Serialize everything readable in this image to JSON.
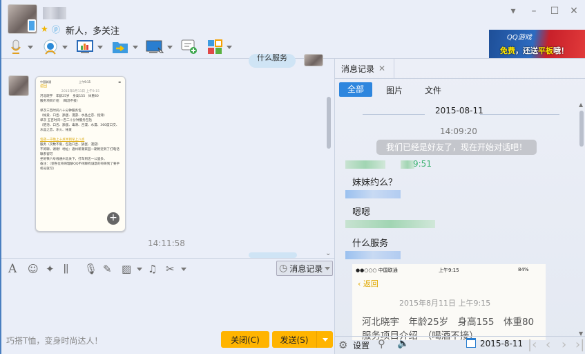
{
  "header": {
    "signature": "新人，多关注"
  },
  "toolbar": {
    "icons": [
      "microphone-icon",
      "video-camera-icon",
      "screen-share-icon",
      "file-transfer-icon",
      "remote-desktop-icon",
      "add-chat-icon",
      "apps-icon"
    ]
  },
  "ad": {
    "brand": "QQ游戏",
    "slogan_a": "免费",
    "slogan_b": "，还送",
    "slogan_c": "平板",
    "slogan_d": "哦！"
  },
  "chat": {
    "top_bubble_text": "什么服务",
    "image_message": {
      "status_left": "中国联通",
      "status_time": "上午9:15",
      "back": "返回",
      "date": "2015年8月11日 上午9:15",
      "lines": [
        "河北晓宇　年龄25岁　身高155　体重80",
        "服务项目介绍　（喝酒不接）",
        "",
        "单次三百时间八十分钟服务包",
        "（帐爱、口舌、舔蛋、漫游、水晶之恋、指滑）",
        "单次 五百时间一百二十分钟服务包括",
        "（陪浴、口舌、舔蛋、毒滑、舌漫、水漫、360度口交、水晶之恋、冰火、帐爱",
        "",
        "包夜一千晚上十点半到早上八点",
        "服务（次数不限，包括口舌、舔蛋、漫游）",
        "不闲聊，谢谢！地址：通州新潮家园一期附近到了打电话联系留可",
        "坐地铁六号线通州北关下，打车到这一公里多。",
        "备注：（望各位哥哥理解QQ不闲聊有诚意的哥哥到了要手机号就可）"
      ]
    },
    "timestamp": "14:11:58"
  },
  "input_toolbar": {
    "history_label": "消息记录"
  },
  "input": {
    "tip": "巧搭T恤，变身时尚达人！",
    "close_label": "关闭(C)",
    "send_label": "发送(S)"
  },
  "history": {
    "tab_label": "消息记录",
    "filters": [
      "全部",
      "图片",
      "文件"
    ],
    "date": "2015-08-11",
    "time1": "14:09:20",
    "system_msg": "我们已经是好友了，现在开始对话吧！",
    "time2_partial": "9:51",
    "messages": [
      "妹妹约么？",
      "嗯嗯",
      "什么服务"
    ],
    "image": {
      "carrier": "●●○○○ 中国联通",
      "time": "上午9:15",
      "battery": "84%",
      "back": "返回",
      "date": "2015年8月11日 上午9:15",
      "line1": "河北晓宇　年龄25岁　身高155　体重80",
      "line2": "服务项目介绍　（喝酒不接）"
    },
    "settings_label": "设置",
    "date_picker": "2015-8-11"
  },
  "colors": {
    "accent": "#2e86de",
    "send": "#ffb400",
    "green_time": "#3cb371"
  }
}
